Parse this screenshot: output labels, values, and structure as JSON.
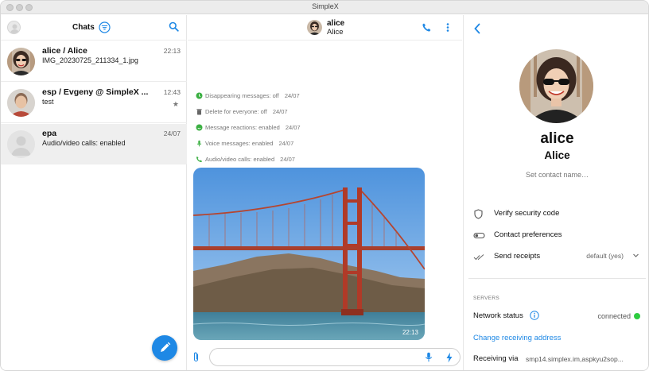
{
  "window": {
    "title": "SimpleX"
  },
  "chat_list": {
    "header_title": "Chats",
    "items": [
      {
        "name": "alice / Alice",
        "preview": "IMG_20230725_211334_1.jpg",
        "time": "22:13",
        "badge": ""
      },
      {
        "name": "esp / Evgeny @ SimpleX ...",
        "preview": "test",
        "time": "12:43",
        "badge": "★"
      },
      {
        "name": "epa",
        "preview": "Audio/video calls: enabled",
        "time": "24/07",
        "badge": ""
      }
    ]
  },
  "conversation": {
    "contact_name": "alice",
    "contact_full_name": "Alice",
    "feature_events": [
      {
        "text": "Disappearing messages: off",
        "time": "24/07",
        "icon": "timer-icon"
      },
      {
        "text": "Delete for everyone: off",
        "time": "24/07",
        "icon": "trash-icon"
      },
      {
        "text": "Message reactions: enabled",
        "time": "24/07",
        "icon": "smile-icon"
      },
      {
        "text": "Voice messages: enabled",
        "time": "24/07",
        "icon": "mic-icon"
      },
      {
        "text": "Audio/video calls: enabled",
        "time": "24/07",
        "icon": "phone-icon"
      }
    ],
    "image_message": {
      "time": "22:13",
      "icon": "bridge-photo"
    },
    "composer": {
      "placeholder": ""
    }
  },
  "contact_info": {
    "display_name": "alice",
    "full_name": "Alice",
    "set_name_label": "Set contact name…",
    "rows": [
      {
        "label": "Verify security code",
        "value": "",
        "icon": "shield-icon"
      },
      {
        "label": "Contact preferences",
        "value": "",
        "icon": "toggle-icon"
      },
      {
        "label": "Send receipts",
        "value": "default (yes)",
        "icon": "double-check-icon"
      }
    ],
    "servers_section": "SERVERS",
    "network_status_label": "Network status",
    "network_status_value": "connected",
    "change_address_link": "Change receiving address",
    "receiving_via_label": "Receiving via",
    "receiving_via_value": "smp14.simplex.im,aspkyu2sop..."
  },
  "colors": {
    "accent": "#1e88e5",
    "connected": "#2ecc40",
    "feature_green": "#3cb043"
  }
}
